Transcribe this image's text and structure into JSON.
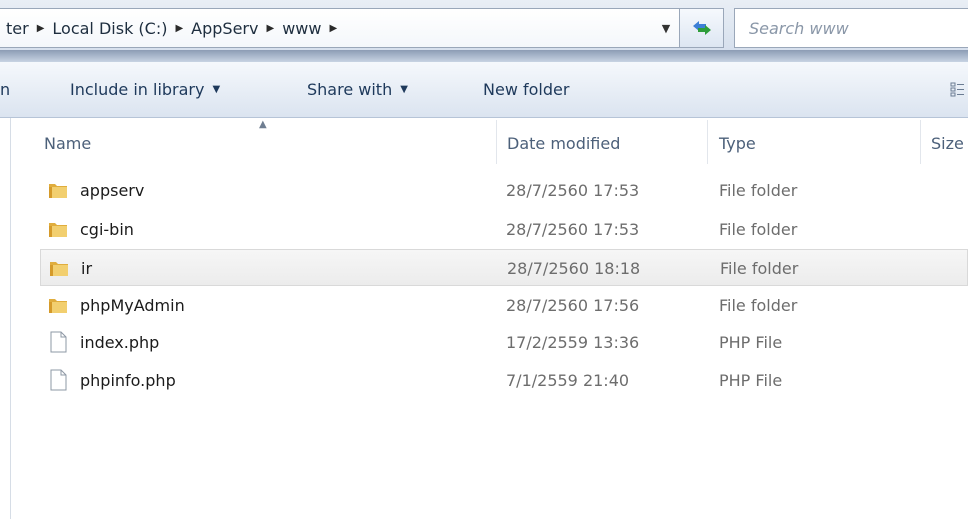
{
  "address": {
    "crumbs": [
      "ter",
      "Local Disk (C:)",
      "AppServ",
      "www"
    ],
    "separator_glyph": "▶"
  },
  "search": {
    "placeholder": "Search www"
  },
  "toolbar": {
    "partial_left": "n",
    "include_library": "Include in library",
    "share_with": "Share with",
    "new_folder": "New folder",
    "dropdown_glyph": "▼"
  },
  "columns": {
    "name": "Name",
    "date_modified": "Date modified",
    "type": "Type",
    "size": "Size"
  },
  "files": [
    {
      "name": "appserv",
      "date": "28/7/2560 17:53",
      "type": "File folder",
      "icon": "folder-icon"
    },
    {
      "name": "cgi-bin",
      "date": "28/7/2560 17:53",
      "type": "File folder",
      "icon": "folder-icon"
    },
    {
      "name": "ir",
      "date": "28/7/2560 18:18",
      "type": "File folder",
      "icon": "folder-icon",
      "selected": true
    },
    {
      "name": "phpMyAdmin",
      "date": "28/7/2560 17:56",
      "type": "File folder",
      "icon": "folder-icon"
    },
    {
      "name": "index.php",
      "date": "17/2/2559 13:36",
      "type": "PHP File",
      "icon": "file-icon"
    },
    {
      "name": "phpinfo.php",
      "date": "7/1/2559 21:40",
      "type": "PHP File",
      "icon": "file-icon"
    }
  ],
  "colors": {
    "toolbar_text": "#1e395b",
    "folder": "#e8b94a",
    "selected_row": "#ececec"
  }
}
